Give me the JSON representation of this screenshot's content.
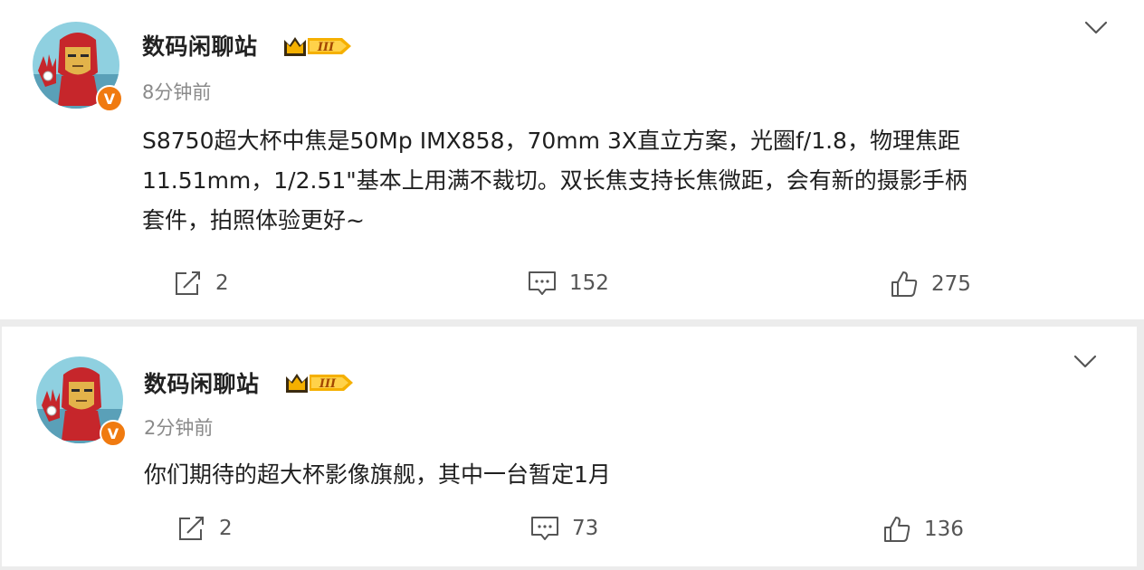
{
  "posts": [
    {
      "author": "数码闲聊站",
      "level_badge": "III",
      "verified_badge": "V",
      "time": "8分钟前",
      "content_lines": [
        "S8750超大杯中焦是50Mp IMX858，70mm 3X直立方案，光圈f/1.8，物理焦距",
        "11.51mm，1/2.51\"基本上用满不裁切。双长焦支持长焦微距，会有新的摄影手柄",
        "套件，拍照体验更好~"
      ],
      "reposts": "2",
      "comments": "152",
      "likes": "275"
    },
    {
      "author": "数码闲聊站",
      "level_badge": "III",
      "verified_badge": "V",
      "time": "2分钟前",
      "content_lines": [
        "你们期待的超大杯影像旗舰，其中一台暂定1月"
      ],
      "reposts": "2",
      "comments": "73",
      "likes": "136"
    }
  ],
  "icons": {
    "more": "chevron-down-icon",
    "repost": "repost-icon",
    "comment": "comment-icon",
    "like": "thumbs-up-icon"
  },
  "colors": {
    "verified_badge": "#f07a10",
    "level_badge_gold": "#f5b000",
    "avatar_red": "#c6262b",
    "avatar_gold": "#e3b34a"
  }
}
